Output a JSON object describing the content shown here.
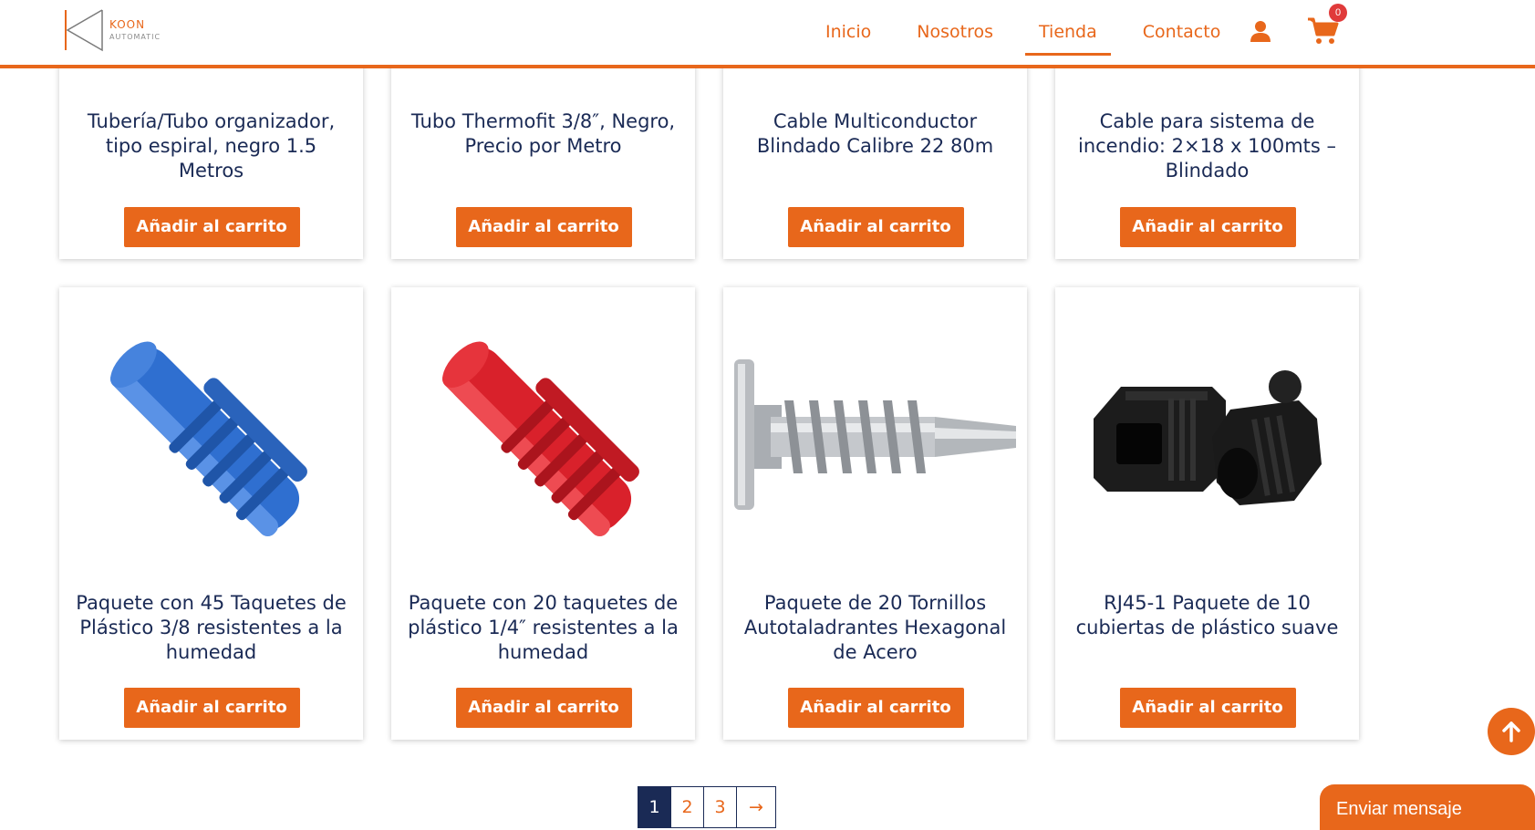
{
  "brand": {
    "name": "KOON",
    "sub": "AUTOMATIC"
  },
  "nav": {
    "items": [
      {
        "label": "Inicio"
      },
      {
        "label": "Nosotros"
      },
      {
        "label": "Tienda",
        "active": true
      },
      {
        "label": "Contacto"
      }
    ]
  },
  "cart": {
    "count": "0"
  },
  "colors": {
    "accent": "#e8671b",
    "title": "#1a2a55",
    "badge": "#e03a3a"
  },
  "products_top": [
    {
      "title": "Tubería/Tubo organizador, tipo espiral, negro 1.5 Metros",
      "button": "Añadir al carrito"
    },
    {
      "title": "Tubo Thermofit 3/8″, Negro, Precio por Metro",
      "button": "Añadir al carrito"
    },
    {
      "title": "Cable Multiconductor Blindado Calibre 22 80m",
      "button": "Añadir al carrito"
    },
    {
      "title": "Cable para sistema de incendio: 2×18 x 100mts – Blindado",
      "button": "Añadir al carrito"
    }
  ],
  "products_bottom": [
    {
      "title": "Paquete con 45 Taquetes de Plástico 3/8 resistentes a la humedad",
      "button": "Añadir al carrito",
      "image": "blue-wall-plug"
    },
    {
      "title": "Paquete con 20 taquetes de plástico 1/4″ resistentes a la humedad",
      "button": "Añadir al carrito",
      "image": "red-wall-plug"
    },
    {
      "title": "Paquete de 20 Tornillos Autotaladrantes Hexagonal de Acero",
      "button": "Añadir al carrito",
      "image": "self-drilling-screw"
    },
    {
      "title": "RJ45-1 Paquete de 10 cubiertas de plástico suave",
      "button": "Añadir al carrito",
      "image": "black-rj45-boots"
    }
  ],
  "pagination": {
    "pages": [
      "1",
      "2",
      "3"
    ],
    "current": "1",
    "next": "→"
  },
  "chat": {
    "label": "Enviar mensaje"
  },
  "icons": {
    "user": "user-icon",
    "cart": "cart-icon",
    "scroll_top": "arrow-up-icon"
  }
}
